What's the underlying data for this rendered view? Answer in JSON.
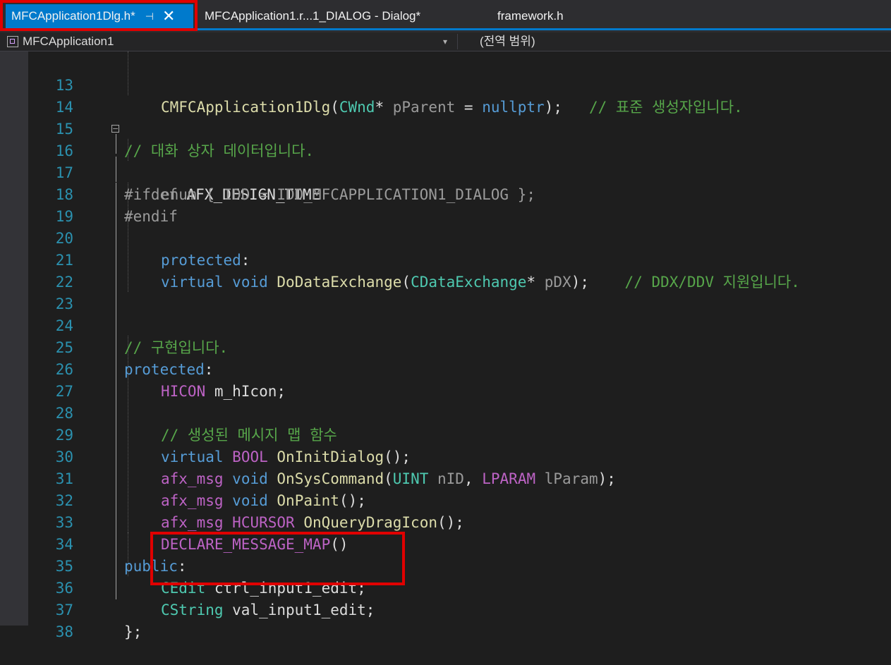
{
  "tabs": {
    "active": {
      "label": "MFCApplication1Dlg.h*",
      "pin": "⊣",
      "close": "✕"
    },
    "tab2": {
      "label": "MFCApplication1.r...1_DIALOG - Dialog*"
    },
    "tab3": {
      "label": "framework.h"
    }
  },
  "navbar": {
    "project": "MFCApplication1",
    "scope": "(전역 범위)"
  },
  "code": {
    "l13": {
      "num": "13",
      "t1": "CMFCApplication1Dlg",
      "t2": "(",
      "t3": "CWnd",
      "t4": "* ",
      "t5": "pParent",
      "t6": " = ",
      "t7": "nullptr",
      "t8": ");   ",
      "t9": "// 표준 생성자입니다."
    },
    "l14": {
      "num": "14"
    },
    "l15": {
      "num": "15",
      "t1": "// 대화 상자 데이터입니다."
    },
    "l16": {
      "num": "16",
      "t1": "#ifdef ",
      "t2": "AFX_DESIGN_TIME"
    },
    "l17": {
      "num": "17",
      "t1": "enum { IDD = IDD_MFCAPPLICATION1_DIALOG };"
    },
    "l18": {
      "num": "18",
      "t1": "#endif"
    },
    "l19": {
      "num": "19"
    },
    "l20": {
      "num": "20",
      "t1": "protected",
      "t2": ":"
    },
    "l21": {
      "num": "21",
      "t1": "virtual",
      "t2": " ",
      "t3": "void",
      "t4": " ",
      "t5": "DoDataExchange",
      "t6": "(",
      "t7": "CDataExchange",
      "t8": "* ",
      "t9": "pDX",
      "t10": ");    ",
      "t11": "// DDX/DDV 지원입니다."
    },
    "l22": {
      "num": "22"
    },
    "l23": {
      "num": "23"
    },
    "l24": {
      "num": "24",
      "t1": "// 구현입니다."
    },
    "l25": {
      "num": "25",
      "t1": "protected",
      "t2": ":"
    },
    "l26": {
      "num": "26",
      "t1": "HICON",
      "t2": " m_hIcon;"
    },
    "l27": {
      "num": "27"
    },
    "l28": {
      "num": "28",
      "t1": "// 생성된 메시지 맵 함수"
    },
    "l29": {
      "num": "29",
      "t1": "virtual",
      "t2": " ",
      "t3": "BOOL",
      "t4": " ",
      "t5": "OnInitDialog",
      "t6": "();"
    },
    "l30": {
      "num": "30",
      "t1": "afx_msg",
      "t2": " ",
      "t3": "void",
      "t4": " ",
      "t5": "OnSysCommand",
      "t6": "(",
      "t7": "UINT",
      "t8": " ",
      "t9": "nID",
      "t10": ", ",
      "t11": "LPARAM",
      "t12": " ",
      "t13": "lParam",
      "t14": ");"
    },
    "l31": {
      "num": "31",
      "t1": "afx_msg",
      "t2": " ",
      "t3": "void",
      "t4": " ",
      "t5": "OnPaint",
      "t6": "();"
    },
    "l32": {
      "num": "32",
      "t1": "afx_msg",
      "t2": " ",
      "t3": "HCURSOR",
      "t4": " ",
      "t5": "OnQueryDragIcon",
      "t6": "();"
    },
    "l33": {
      "num": "33",
      "t1": "DECLARE_MESSAGE_MAP",
      "t2": "()"
    },
    "l34": {
      "num": "34",
      "t1": "public",
      "t2": ":"
    },
    "l35": {
      "num": "35",
      "t1": "CEdit",
      "t2": " ctrl_input1_edit;"
    },
    "l36": {
      "num": "36",
      "t1": "CString",
      "t2": " val_input1_edit;"
    },
    "l37": {
      "num": "37",
      "t1": "};"
    },
    "l38": {
      "num": "38"
    }
  },
  "colors": {
    "tab_active_bg": "#007acc",
    "highlight_border": "#e00000",
    "keyword": "#569cd6",
    "type": "#4ec9b0",
    "macro": "#bd63c5",
    "comment": "#57a64a",
    "line_number": "#2b91af"
  }
}
